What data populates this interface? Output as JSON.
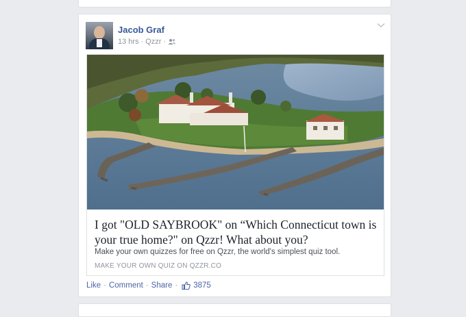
{
  "post": {
    "author": "Jacob Graf",
    "time": "13 hrs",
    "source": "Qzzr",
    "audience_icon": "friends-icon",
    "menu_icon": "chevron-down-icon",
    "attachment": {
      "image_alt": "Aerial view of a waterfront estate with stone jetties",
      "title": "I got \"OLD SAYBROOK\" on “Which Connecticut town is your true home?\" on Qzzr! What about you?",
      "description": "Make your own quizzes for free on Qzzr, the world's simplest quiz tool.",
      "domain": "MAKE YOUR OWN QUIZ ON QZZR.CO"
    },
    "actions": {
      "like": "Like",
      "comment": "Comment",
      "share": "Share",
      "like_count": "3875"
    }
  },
  "colors": {
    "background": "#e9ebee",
    "link": "#365899",
    "action": "#4b64a6",
    "meta": "#90949c"
  }
}
